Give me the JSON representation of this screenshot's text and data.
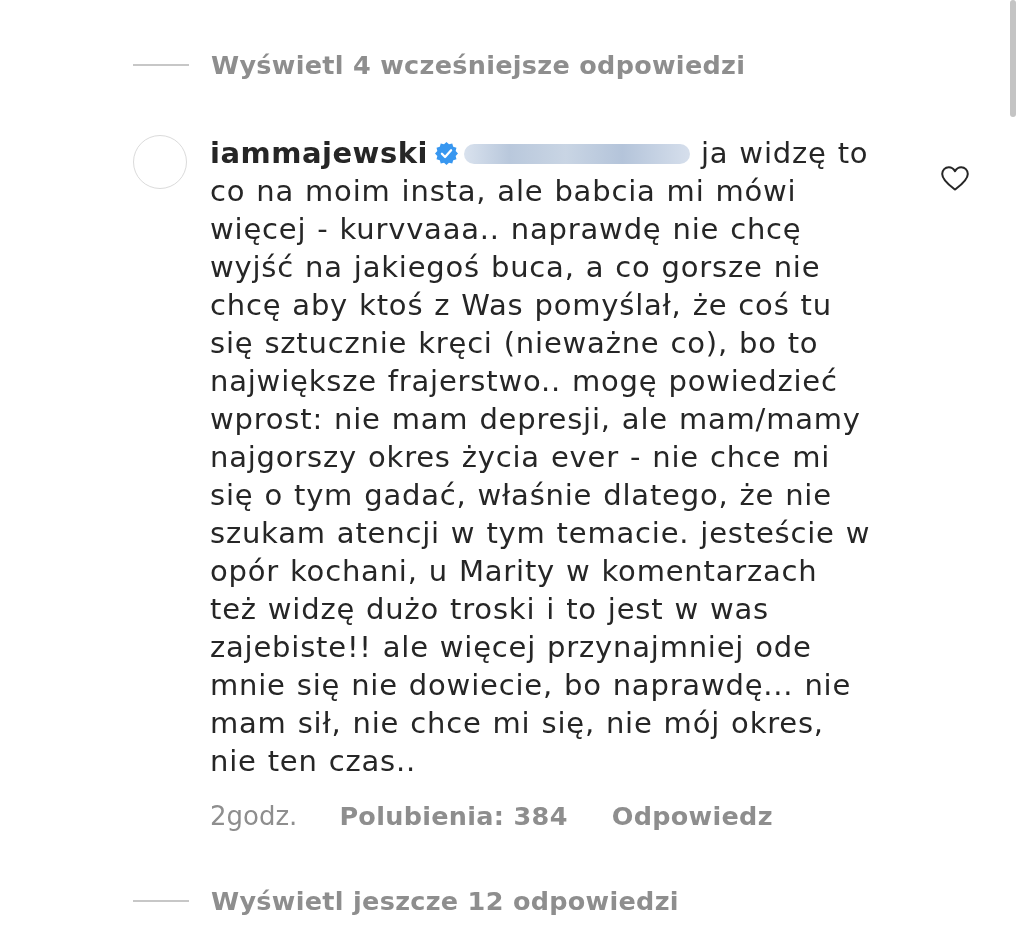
{
  "previous_replies": {
    "label": "Wyświetl 4 wcześniejsze odpowiedzi"
  },
  "comment": {
    "username": "iammajewski",
    "verified": true,
    "text": "ja widzę to co na moim insta, ale babcia mi mówi więcej - kurvvaaa.. naprawdę nie chcę wyjść na jakiegoś buca, a co gorsze nie chcę aby ktoś z Was pomyślał, że coś tu się sztucznie kręci (nieważne co), bo to największe frajerstwo.. mogę powiedzieć wprost: nie mam depresji, ale mam/mamy najgorszy okres życia ever - nie chce mi się o tym gadać, właśnie dlatego, że nie szukam atencji w tym temacie. jesteście w opór kochani, u Marity w komentarzach też widzę dużo troski i to jest w was zajebiste!! ale więcej przynajmniej ode mnie się nie dowiecie, bo naprawdę... nie mam sił, nie chce mi się, nie mój okres, nie ten czas..",
    "liked": false,
    "time": "2godz.",
    "likes": "Polubienia: 384",
    "reply": "Odpowiedz"
  },
  "more_replies": {
    "label": "Wyświetl jeszcze 12 odpowiedzi"
  }
}
